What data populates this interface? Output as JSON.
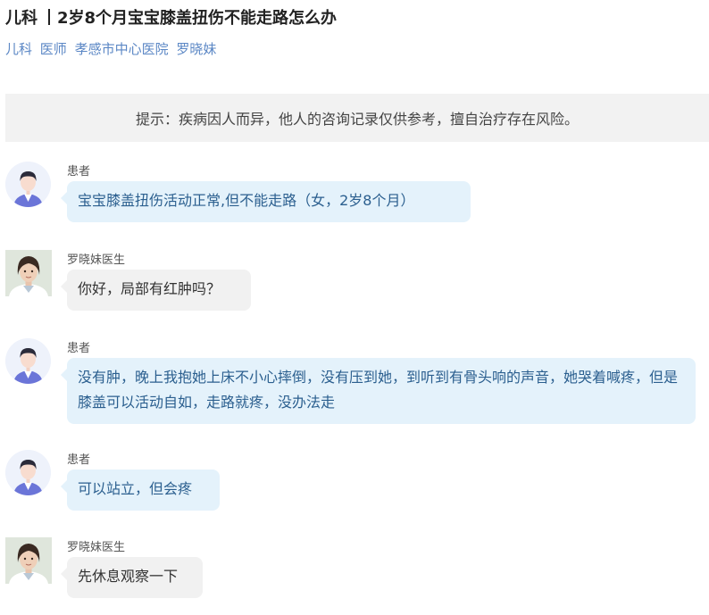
{
  "header": {
    "department": "儿科",
    "question_title": "2岁8个月宝宝膝盖扭伤不能走路怎么办"
  },
  "doctor_info": {
    "department": "儿科",
    "title": "医师",
    "hospital": "孝感市中心医院",
    "name": "罗晓妹"
  },
  "notice": {
    "text": "提示：疾病因人而异，他人的咨询记录仅供参考，擅自治疗存在风险。"
  },
  "messages": [
    {
      "role": "patient",
      "sender": "患者",
      "avatar_icon": "patient-avatar-icon",
      "text": "宝宝膝盖扭伤活动正常,但不能走路（女，2岁8个月）"
    },
    {
      "role": "doctor",
      "sender": "罗晓妹医生",
      "avatar_icon": "doctor-photo",
      "text": "你好，局部有红肿吗？"
    },
    {
      "role": "patient",
      "sender": "患者",
      "avatar_icon": "patient-avatar-icon",
      "text": "没有肿，晚上我抱她上床不小心摔倒，没有压到她，到听到有骨头响的声音，她哭着喊疼，但是膝盖可以活动自如，走路就疼，没办法走"
    },
    {
      "role": "patient",
      "sender": "患者",
      "avatar_icon": "patient-avatar-icon",
      "text": "可以站立，但会疼"
    },
    {
      "role": "doctor",
      "sender": "罗晓妹医生",
      "avatar_icon": "doctor-photo",
      "text": "先休息观察一下"
    }
  ],
  "colors": {
    "link": "#5b87c5",
    "patient_bubble": "#e4f2fb",
    "patient_text": "#2b5f8f",
    "doctor_bubble": "#f1f1f1",
    "notice_bg": "#f2f2f2"
  }
}
